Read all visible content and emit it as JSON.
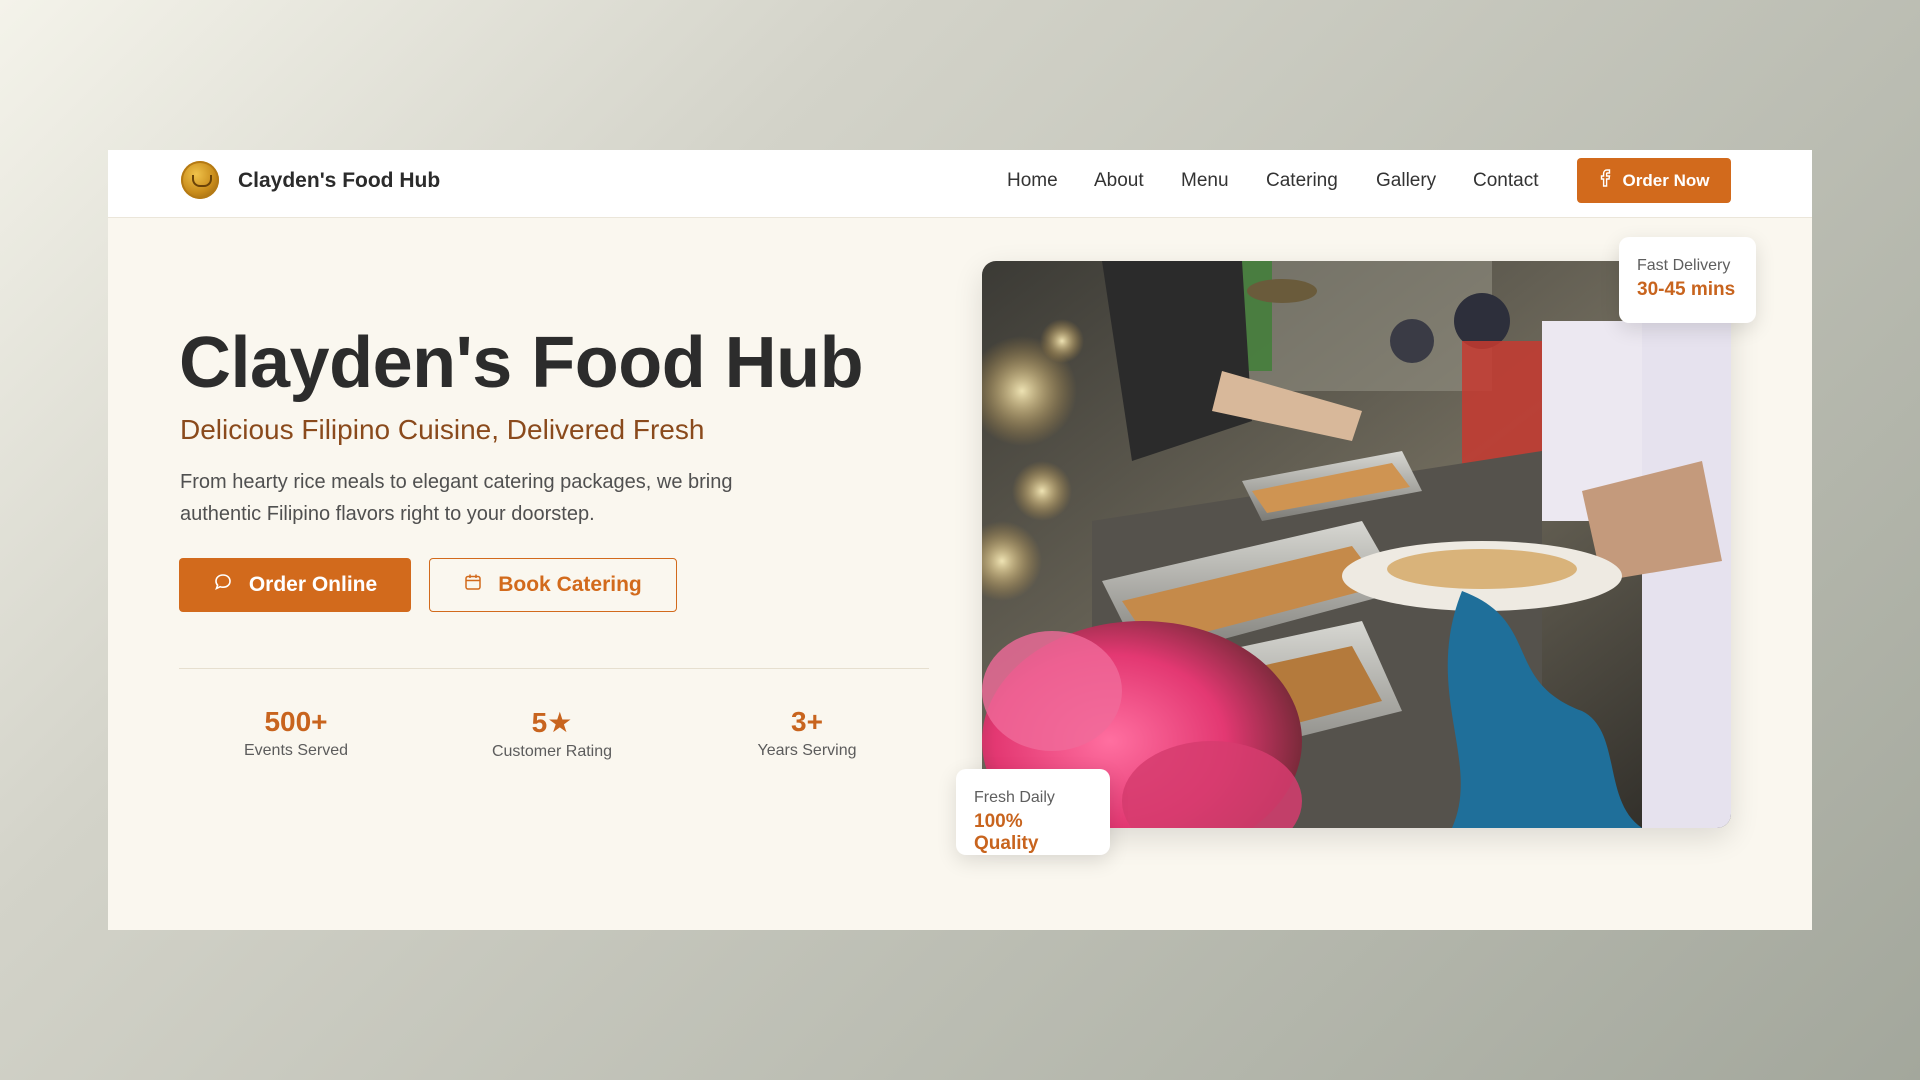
{
  "header": {
    "brand": "Clayden's Food Hub",
    "nav": [
      "Home",
      "About",
      "Menu",
      "Catering",
      "Gallery",
      "Contact"
    ],
    "cta_label": "Order Now",
    "cta_icon": "facebook-icon"
  },
  "hero": {
    "title": "Clayden's Food Hub",
    "subtitle": "Delicious Filipino Cuisine, Delivered Fresh",
    "description": "From hearty rice meals to elegant catering packages, we bring authentic Filipino flavors right to your doorstep.",
    "primary_button": "Order Online",
    "primary_icon": "chat-bubble-icon",
    "secondary_button": "Book Catering",
    "secondary_icon": "calendar-icon"
  },
  "stats": [
    {
      "value": "500+",
      "label": "Events Served"
    },
    {
      "value": "5★",
      "label": "Customer Rating"
    },
    {
      "value": "3+",
      "label": "Years Serving"
    }
  ],
  "badges": {
    "delivery": {
      "label": "Fast Delivery",
      "value": "30-45 mins"
    },
    "quality": {
      "label": "Fresh Daily",
      "value": "100% Quality"
    }
  },
  "colors": {
    "accent": "#d26a1c",
    "subtitle": "#8a4a1c",
    "background": "#faf7ef"
  }
}
